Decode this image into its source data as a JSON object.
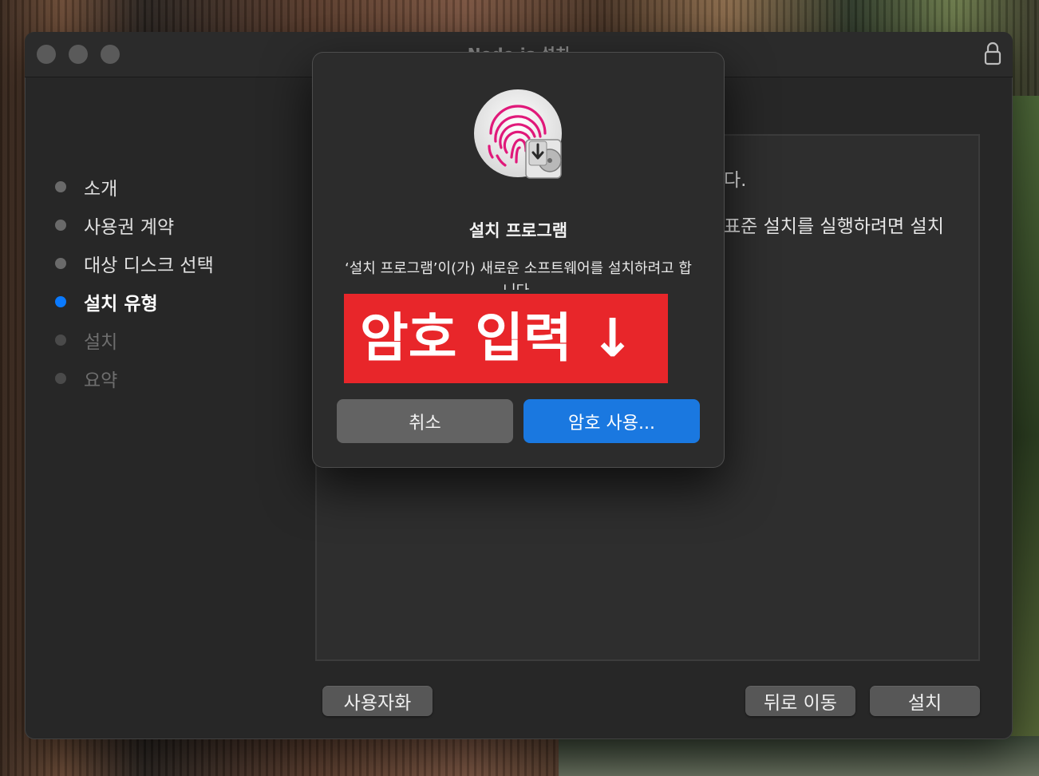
{
  "window": {
    "title": "Node.js 설치"
  },
  "sidebar": {
    "steps": [
      {
        "label": "소개",
        "state": "done"
      },
      {
        "label": "사용권 계약",
        "state": "done"
      },
      {
        "label": "대상 디스크 선택",
        "state": "done"
      },
      {
        "label": "설치 유형",
        "state": "active"
      },
      {
        "label": "설치",
        "state": "pending"
      },
      {
        "label": "요약",
        "state": "pending"
      }
    ]
  },
  "content": {
    "line1": "다.",
    "line2": "표준 설치를 실행하려면 설치"
  },
  "buttons": {
    "customize": "사용자화",
    "back": "뒤로 이동",
    "install": "설치"
  },
  "dialog": {
    "icon": "touch-id-fingerprint-installer-icon",
    "title": "설치 프로그램",
    "message": "‘설치 프로그램’이(가) 새로운 소프트웨어를 설치하려고 합니다.",
    "overlay_text": "암호 입력 ↓",
    "cancel_label": "취소",
    "use_password_label": "암호 사용..."
  },
  "colors": {
    "accent": "#0a7aff",
    "overlay_red": "#e8262a",
    "primary_button": "#1a78e0"
  }
}
